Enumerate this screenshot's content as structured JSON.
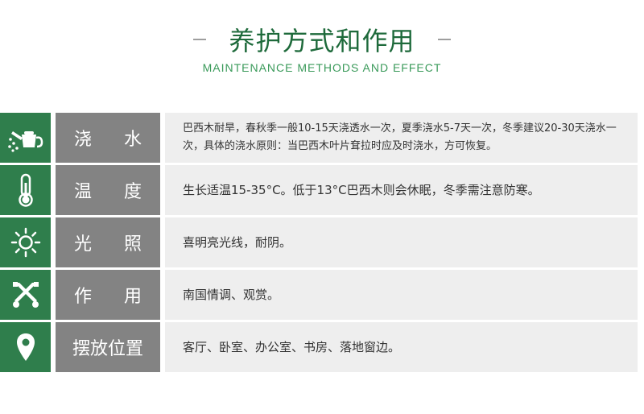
{
  "header": {
    "title": "养护方式和作用",
    "subtitle": "MAINTENANCE  METHODS AND EFFECT"
  },
  "rows": [
    {
      "icon": "watering-can-icon",
      "label": "浇水",
      "content": "巴西木耐旱，春秋季一般10-15天浇透水一次，夏季浇水5-7天一次，冬季建议20-30天浇水一次，具体的浇水原则：当巴西木叶片耷拉时应及时浇水，方可恢复。"
    },
    {
      "icon": "thermometer-icon",
      "label": "温度",
      "content": "生长适温15-35°C。低于13°C巴西木则会休眠，冬季需注意防寒。"
    },
    {
      "icon": "sun-icon",
      "label": "光照",
      "content": "喜明亮光线，耐阴。"
    },
    {
      "icon": "tools-cross-icon",
      "label": "作用",
      "content": "南国情调、观赏。"
    },
    {
      "icon": "location-pin-icon",
      "label": "摆放位置",
      "content": "客厅、卧室、办公室、书房、落地窗边。"
    }
  ],
  "colors": {
    "title": "#1e6a3b",
    "subtitle": "#3a9a5a",
    "icon_bg": "#2f7e4c",
    "label_bg": "#838383",
    "content_bg": "#eeeeee"
  }
}
